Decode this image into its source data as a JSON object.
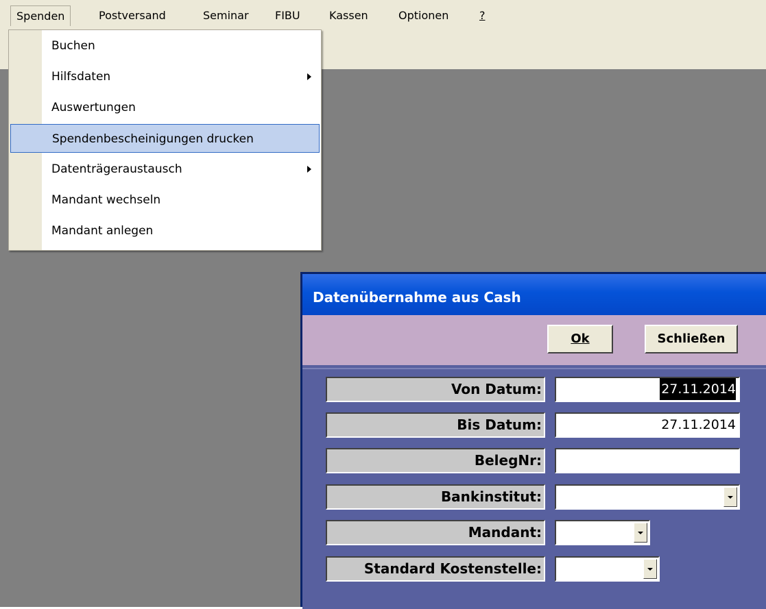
{
  "menubar": {
    "items": [
      "Spenden",
      "Postversand",
      "Seminar",
      "FIBU",
      "Kassen",
      "Optionen",
      "?"
    ]
  },
  "menu": {
    "items": [
      {
        "label": "Buchen",
        "submenu": false
      },
      {
        "label": "Hilfsdaten",
        "submenu": true
      },
      {
        "label": "Auswertungen",
        "submenu": false
      },
      {
        "label": "Spendenbescheinigungen drucken",
        "submenu": false,
        "highlighted": true
      },
      {
        "label": "Datenträgeraustausch",
        "submenu": true
      },
      {
        "label": "Mandant wechseln",
        "submenu": false
      },
      {
        "label": "Mandant anlegen",
        "submenu": false
      }
    ]
  },
  "dialog": {
    "title": "Datenübernahme aus Cash",
    "ok_label": "Ok",
    "close_label": "Schließen",
    "fields": {
      "von_datum": {
        "label": "Von Datum:",
        "value": "27.11.2014"
      },
      "bis_datum": {
        "label": "Bis Datum:",
        "value": "27.11.2014"
      },
      "beleg_nr": {
        "label": "BelegNr:",
        "value": ""
      },
      "bankinstitut": {
        "label": "Bankinstitut:",
        "value": ""
      },
      "mandant": {
        "label": "Mandant:",
        "value": ""
      },
      "kostenstelle": {
        "label": "Standard Kostenstelle:",
        "value": ""
      }
    }
  },
  "colors": {
    "workspace": "#808080",
    "dialog_body": "#58609f",
    "button_bar": "#c4aac8",
    "titlebar": "#0553d8",
    "menu_highlight": "#c1d2ee"
  }
}
